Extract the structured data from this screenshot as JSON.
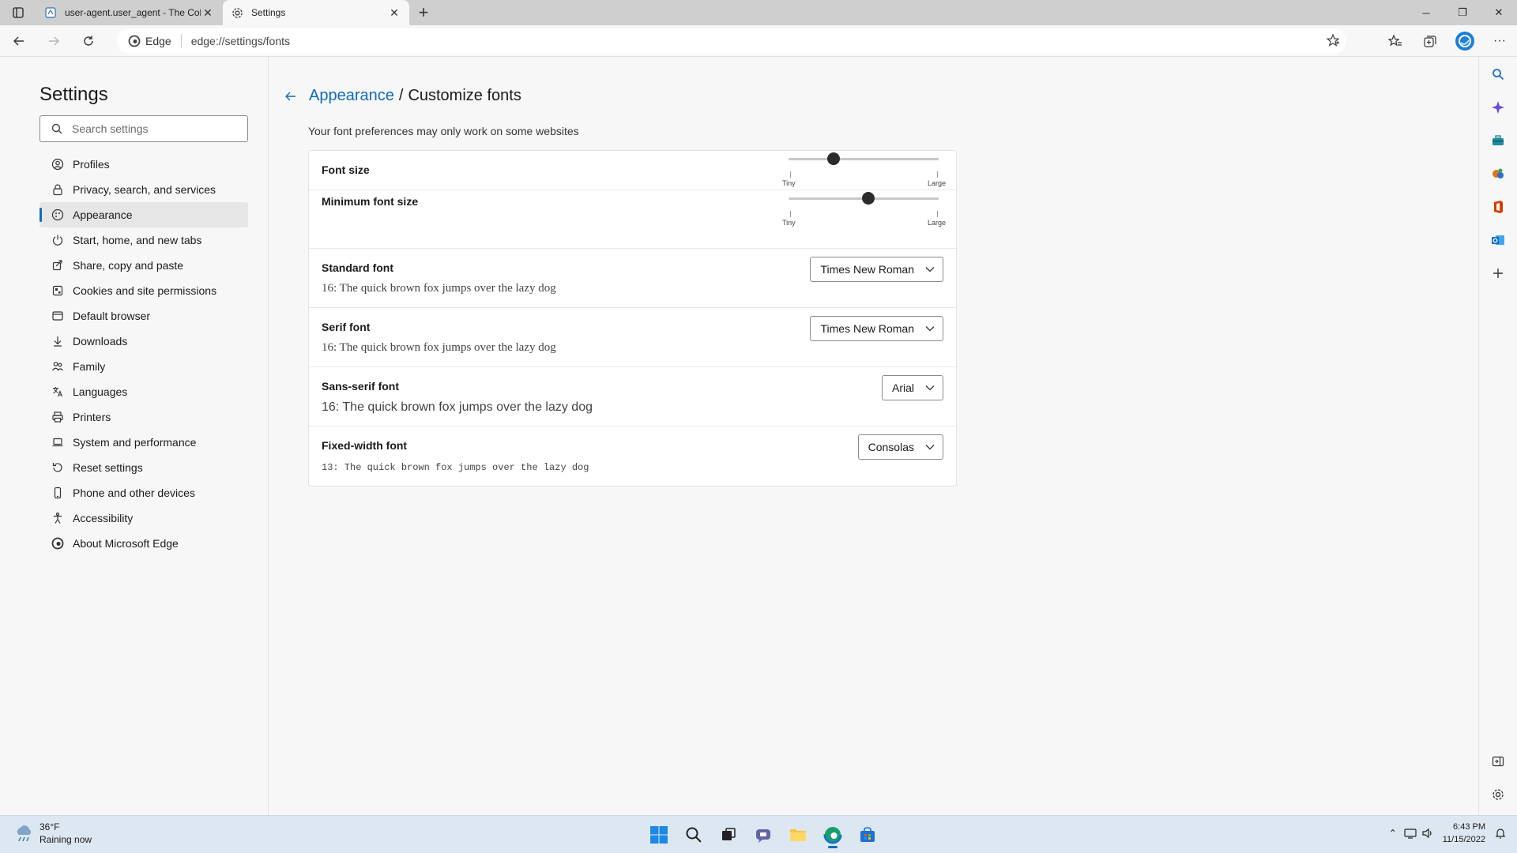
{
  "browser": {
    "tabs": [
      {
        "title": "user-agent.user_agent - The Coll",
        "active": false
      },
      {
        "title": "Settings",
        "active": true
      }
    ],
    "address": {
      "chip": "Edge",
      "url": "edge://settings/fonts"
    }
  },
  "sidebar": {
    "title": "Settings",
    "search_placeholder": "Search settings",
    "items": [
      {
        "label": "Profiles",
        "icon": "profile-icon"
      },
      {
        "label": "Privacy, search, and services",
        "icon": "lock-icon"
      },
      {
        "label": "Appearance",
        "icon": "appearance-icon",
        "selected": true
      },
      {
        "label": "Start, home, and new tabs",
        "icon": "power-icon"
      },
      {
        "label": "Share, copy and paste",
        "icon": "share-icon"
      },
      {
        "label": "Cookies and site permissions",
        "icon": "cookies-icon"
      },
      {
        "label": "Default browser",
        "icon": "browser-icon"
      },
      {
        "label": "Downloads",
        "icon": "download-icon"
      },
      {
        "label": "Family",
        "icon": "family-icon"
      },
      {
        "label": "Languages",
        "icon": "languages-icon"
      },
      {
        "label": "Printers",
        "icon": "printer-icon"
      },
      {
        "label": "System and performance",
        "icon": "laptop-icon"
      },
      {
        "label": "Reset settings",
        "icon": "reset-icon"
      },
      {
        "label": "Phone and other devices",
        "icon": "phone-icon"
      },
      {
        "label": "Accessibility",
        "icon": "accessibility-icon"
      },
      {
        "label": "About Microsoft Edge",
        "icon": "edge-logo-icon"
      }
    ]
  },
  "main": {
    "breadcrumb_parent": "Appearance",
    "breadcrumb_sep": "/",
    "breadcrumb_current": "Customize fonts",
    "note": "Your font preferences may only work on some websites",
    "font_size": {
      "label": "Font size",
      "min_label": "Tiny",
      "max_label": "Large",
      "value_fraction": 0.3
    },
    "min_font_size": {
      "label": "Minimum font size",
      "min_label": "Tiny",
      "max_label": "Large",
      "value_fraction": 0.53
    },
    "standard_font": {
      "label": "Standard font",
      "value": "Times New Roman",
      "sample": "16: The quick brown fox jumps over the lazy dog"
    },
    "serif_font": {
      "label": "Serif font",
      "value": "Times New Roman",
      "sample": "16: The quick brown fox jumps over the lazy dog"
    },
    "sans_font": {
      "label": "Sans-serif font",
      "value": "Arial",
      "sample": "16: The quick brown fox jumps over the lazy dog"
    },
    "fixed_font": {
      "label": "Fixed-width font",
      "value": "Consolas",
      "sample": "13: The quick brown fox jumps over the lazy dog"
    }
  },
  "taskbar": {
    "weather_temp": "36°F",
    "weather_desc": "Raining now",
    "time": "6:43 PM",
    "date": "11/15/2022"
  },
  "colors": {
    "accent": "#0f6cbd",
    "taskbar": "#dde7f1"
  }
}
